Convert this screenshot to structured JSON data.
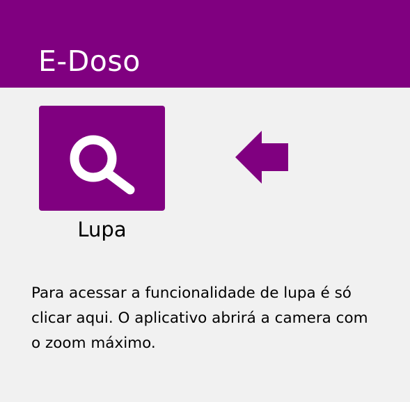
{
  "header": {
    "title": "E-Doso"
  },
  "main": {
    "lupa_button": {
      "icon": "search-icon",
      "label": "Lupa"
    },
    "pointer_icon": "arrow-left-icon",
    "instruction": "Para acessar a funcionalidade de lupa é só clicar aqui. O aplicativo abrirá a camera com o zoom máximo."
  },
  "colors": {
    "brand": "#800080",
    "background": "#f1f1f1",
    "icon_fg": "#ffffff",
    "text": "#000000"
  }
}
